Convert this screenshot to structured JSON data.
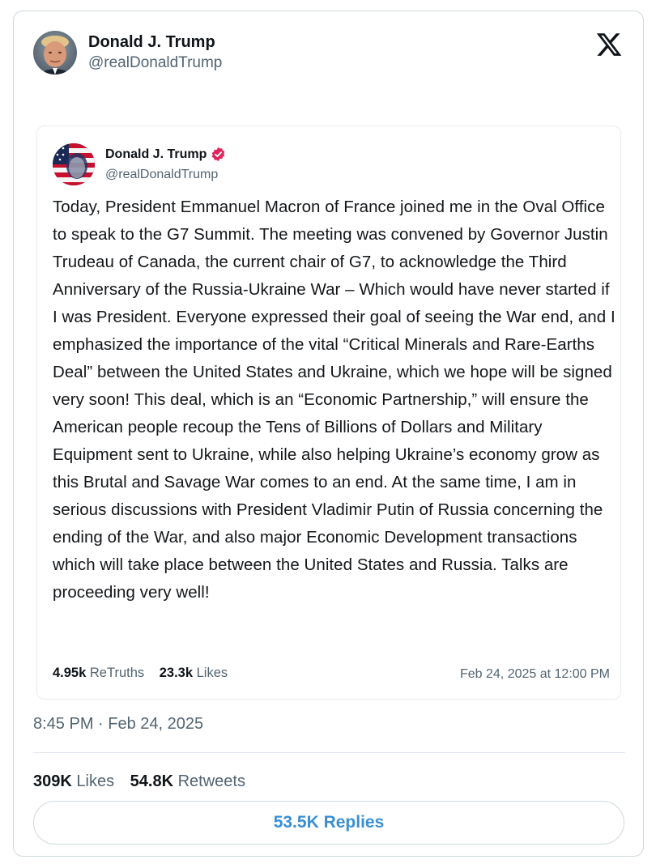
{
  "author": {
    "name": "Donald J. Trump",
    "handle": "@realDonaldTrump"
  },
  "quoted_post": {
    "name": "Donald J. Trump",
    "handle": "@realDonaldTrump",
    "verified_icon": "verified-badge-icon",
    "verified_color": "#e0245e",
    "text": "Today, President Emmanuel Macron of France joined me in the Oval Office to speak to the G7 Summit. The meeting was convened by Governor Justin Trudeau of Canada, the current chair of G7, to acknowledge the Third Anniversary of the Russia-Ukraine War – Which would have never started if I was President. Everyone expressed their goal of seeing the War end, and I emphasized the importance of the vital “Critical Minerals and Rare-Earths Deal” between the United States and Ukraine, which we hope will be signed very soon! This deal, which is an “Economic Partnership,” will ensure the American people recoup the Tens of Billions of Dollars and Military Equipment sent to Ukraine, while also helping Ukraine’s economy grow as this Brutal and Savage War comes to an end. At the same time, I am in serious discussions with President Vladimir Putin of Russia concerning the ending of the War, and also major Economic Development transactions which will take place between the United States and Russia. Talks are proceeding very well!",
    "retruths_count": "4.95k",
    "retruths_label": "ReTruths",
    "likes_count": "23.3k",
    "likes_label": "Likes",
    "timestamp": "Feb 24, 2025 at 12:00 PM"
  },
  "timestamp": "8:45 PM · Feb 24, 2025",
  "stats": {
    "likes_count": "309K",
    "likes_label": "Likes",
    "retweets_count": "54.8K",
    "retweets_label": "Retweets"
  },
  "replies_button": "53.5K Replies",
  "colors": {
    "accent": "#3a8fd4",
    "secondary_text": "#536471",
    "border": "#cfd9de"
  }
}
